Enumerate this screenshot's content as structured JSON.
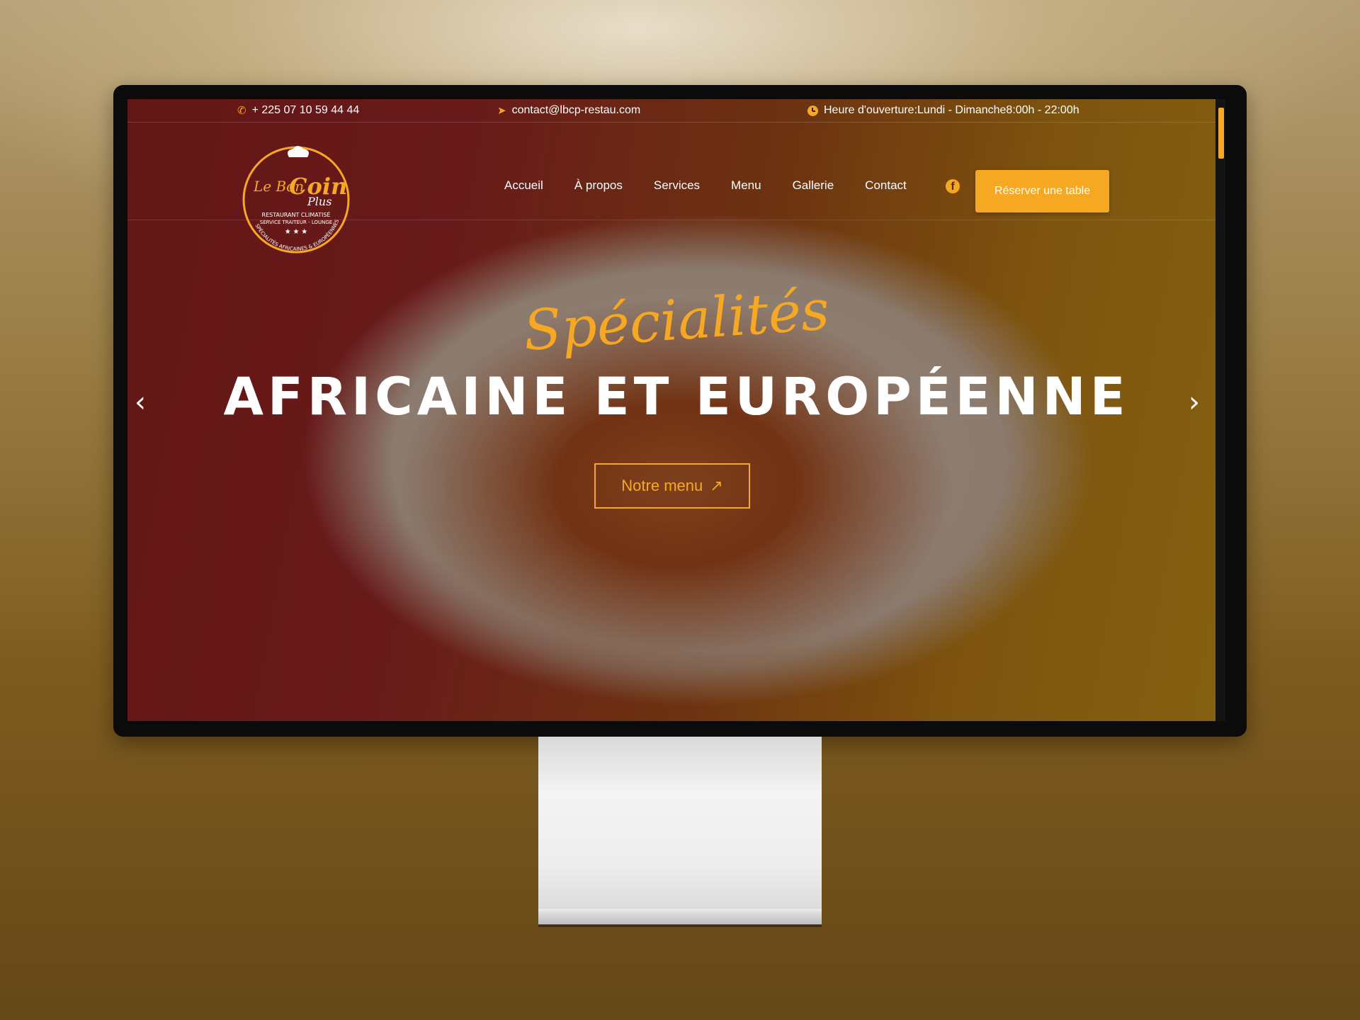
{
  "topbar": {
    "phone": "+ 225 07 10 59 44 44",
    "email": "contact@lbcp-restau.com",
    "hours": "Heure d'ouverture:Lundi - Dimanche8:00h - 22:00h"
  },
  "logo": {
    "line1": "Le Bon",
    "line2": "Coin",
    "line3": "Plus",
    "sub1": "RESTAURANT CLIMATISÉ",
    "sub2": "SERVICE TRAITEUR - LOUNGE",
    "arc": "SPÉCIALITÉS AFRICAINES & EUROPÉENNES"
  },
  "nav": {
    "items": [
      "Accueil",
      "À propos",
      "Services",
      "Menu",
      "Gallerie",
      "Contact"
    ],
    "facebook_icon": "facebook-icon",
    "reserve_label": "Réserver une table"
  },
  "hero": {
    "script": "Spécialités",
    "title": "AFRICAINE ET EUROPÉENNE",
    "button_label": "Notre menu",
    "button_icon": "↗"
  },
  "colors": {
    "accent": "#f7a823",
    "text": "#ffffff"
  }
}
